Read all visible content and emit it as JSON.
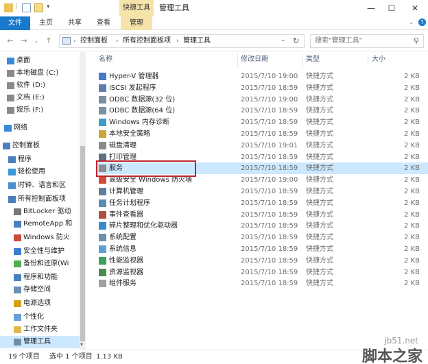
{
  "window": {
    "title": "管理工具",
    "tools_tab": "快捷工具"
  },
  "ribbon": {
    "tabs": [
      "文件",
      "主页",
      "共享",
      "查看",
      "管理"
    ]
  },
  "address": {
    "crumbs": [
      "控制面板",
      "所有控制面板项",
      "管理工具"
    ],
    "search_placeholder": "搜索\"管理工具\""
  },
  "nav": {
    "items": [
      {
        "label": "桌面",
        "icon": "desktop-icon"
      },
      {
        "label": "本地磁盘 (C:)",
        "icon": "drive-icon"
      },
      {
        "label": "软件 (D:)",
        "icon": "drive-icon"
      },
      {
        "label": "文档 (E:)",
        "icon": "drive-icon"
      },
      {
        "label": "娱乐 (F:)",
        "icon": "drive-icon"
      },
      {
        "label": "网络",
        "icon": "network-icon"
      },
      {
        "label": "控制面板",
        "icon": "control-panel-icon"
      },
      {
        "label": "程序",
        "icon": "programs-icon"
      },
      {
        "label": "轻松使用",
        "icon": "ease-of-access-icon"
      },
      {
        "label": "时钟、语言和区",
        "icon": "clock-icon"
      },
      {
        "label": "所有控制面板项",
        "icon": "control-panel-icon"
      },
      {
        "label": "BitLocker 驱动",
        "icon": "bitlocker-icon"
      },
      {
        "label": "RemoteApp 和",
        "icon": "remoteapp-icon"
      },
      {
        "label": "Windows 防火",
        "icon": "firewall-icon"
      },
      {
        "label": "安全性与维护",
        "icon": "flag-icon"
      },
      {
        "label": "备份和还原(Wi",
        "icon": "backup-icon"
      },
      {
        "label": "程序和功能",
        "icon": "programs-icon"
      },
      {
        "label": "存储空间",
        "icon": "storage-icon"
      },
      {
        "label": "电源选项",
        "icon": "power-icon"
      },
      {
        "label": "个性化",
        "icon": "personalize-icon"
      },
      {
        "label": "工作文件夹",
        "icon": "folder-icon"
      },
      {
        "label": "管理工具",
        "icon": "admin-tools-icon"
      }
    ]
  },
  "columns": {
    "name": "名称",
    "date": "修改日期",
    "type": "类型",
    "size": "大小"
  },
  "files": [
    {
      "name": "Hyper-V 管理器",
      "date": "2015/7/10 19:00",
      "type": "快捷方式",
      "size": "2 KB",
      "icon": "hyperv-icon"
    },
    {
      "name": "iSCSI 发起程序",
      "date": "2015/7/10 18:59",
      "type": "快捷方式",
      "size": "2 KB",
      "icon": "iscsi-icon"
    },
    {
      "name": "ODBC 数据源(32 位)",
      "date": "2015/7/10 19:00",
      "type": "快捷方式",
      "size": "2 KB",
      "icon": "odbc-icon"
    },
    {
      "name": "ODBC 数据源(64 位)",
      "date": "2015/7/10 18:59",
      "type": "快捷方式",
      "size": "2 KB",
      "icon": "odbc-icon"
    },
    {
      "name": "Windows 内存诊断",
      "date": "2015/7/10 18:59",
      "type": "快捷方式",
      "size": "2 KB",
      "icon": "memory-icon"
    },
    {
      "name": "本地安全策略",
      "date": "2015/7/10 18:59",
      "type": "快捷方式",
      "size": "2 KB",
      "icon": "policy-icon"
    },
    {
      "name": "磁盘清理",
      "date": "2015/7/10 19:01",
      "type": "快捷方式",
      "size": "2 KB",
      "icon": "cleanup-icon"
    },
    {
      "name": "打印管理",
      "date": "2015/7/10 18:59",
      "type": "快捷方式",
      "size": "2 KB",
      "icon": "printer-icon"
    },
    {
      "name": "服务",
      "date": "2015/7/10 18:59",
      "type": "快捷方式",
      "size": "2 KB",
      "icon": "services-icon"
    },
    {
      "name": "高级安全 Windows 防火墙",
      "date": "2015/7/10 19:00",
      "type": "快捷方式",
      "size": "2 KB",
      "icon": "firewall-icon"
    },
    {
      "name": "计算机管理",
      "date": "2015/7/10 18:59",
      "type": "快捷方式",
      "size": "2 KB",
      "icon": "computer-management-icon"
    },
    {
      "name": "任务计划程序",
      "date": "2015/7/10 18:59",
      "type": "快捷方式",
      "size": "2 KB",
      "icon": "task-scheduler-icon"
    },
    {
      "name": "事件查看器",
      "date": "2015/7/10 18:59",
      "type": "快捷方式",
      "size": "2 KB",
      "icon": "event-viewer-icon"
    },
    {
      "name": "碎片整理和优化驱动器",
      "date": "2015/7/10 18:59",
      "type": "快捷方式",
      "size": "2 KB",
      "icon": "defrag-icon"
    },
    {
      "name": "系统配置",
      "date": "2015/7/10 18:59",
      "type": "快捷方式",
      "size": "2 KB",
      "icon": "config-icon"
    },
    {
      "name": "系统信息",
      "date": "2015/7/10 18:59",
      "type": "快捷方式",
      "size": "2 KB",
      "icon": "sysinfo-icon"
    },
    {
      "name": "性能监视器",
      "date": "2015/7/10 18:59",
      "type": "快捷方式",
      "size": "2 KB",
      "icon": "perfmon-icon"
    },
    {
      "name": "资源监视器",
      "date": "2015/7/10 18:59",
      "type": "快捷方式",
      "size": "2 KB",
      "icon": "resmon-icon"
    },
    {
      "name": "组件服务",
      "date": "2015/7/10 18:59",
      "type": "快捷方式",
      "size": "2 KB",
      "icon": "component-icon"
    }
  ],
  "status": {
    "count": "19 个项目",
    "selected": "选中 1 个项目",
    "size": "1.13 KB"
  },
  "watermark": {
    "site": "jb51.net",
    "text": "脚本之家"
  },
  "colors": {
    "accent": "#1979ca",
    "selection": "#cce8ff",
    "highlight_box": "#c0262c",
    "tools_tab": "#f6e3a9"
  }
}
